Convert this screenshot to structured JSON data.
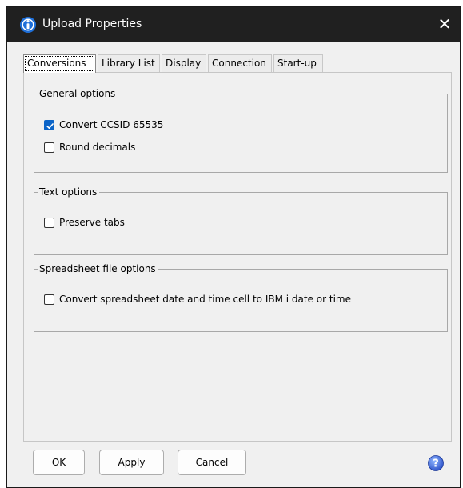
{
  "window": {
    "title": "Upload Properties",
    "close_glyph": "✕"
  },
  "tabs": [
    {
      "label": "Conversions",
      "active": true
    },
    {
      "label": "Library List",
      "active": false
    },
    {
      "label": "Display",
      "active": false
    },
    {
      "label": "Connection",
      "active": false
    },
    {
      "label": "Start-up",
      "active": false
    }
  ],
  "groups": {
    "general": {
      "legend": "General options",
      "options": [
        {
          "label": "Convert CCSID 65535",
          "checked": true
        },
        {
          "label": "Round decimals",
          "checked": false
        }
      ]
    },
    "text": {
      "legend": "Text options",
      "options": [
        {
          "label": "Preserve tabs",
          "checked": false
        }
      ]
    },
    "spreadsheet": {
      "legend": "Spreadsheet file options",
      "options": [
        {
          "label": "Convert spreadsheet date and time cell to IBM i date or time",
          "checked": false
        }
      ]
    }
  },
  "buttons": {
    "ok": "OK",
    "apply": "Apply",
    "cancel": "Cancel"
  },
  "icons": {
    "app": "info-app-icon",
    "help": "help-icon",
    "close": "close-icon"
  },
  "colors": {
    "accent": "#0a64c8",
    "titlebar": "#202020",
    "dialog_bg": "#f0f0f0"
  }
}
